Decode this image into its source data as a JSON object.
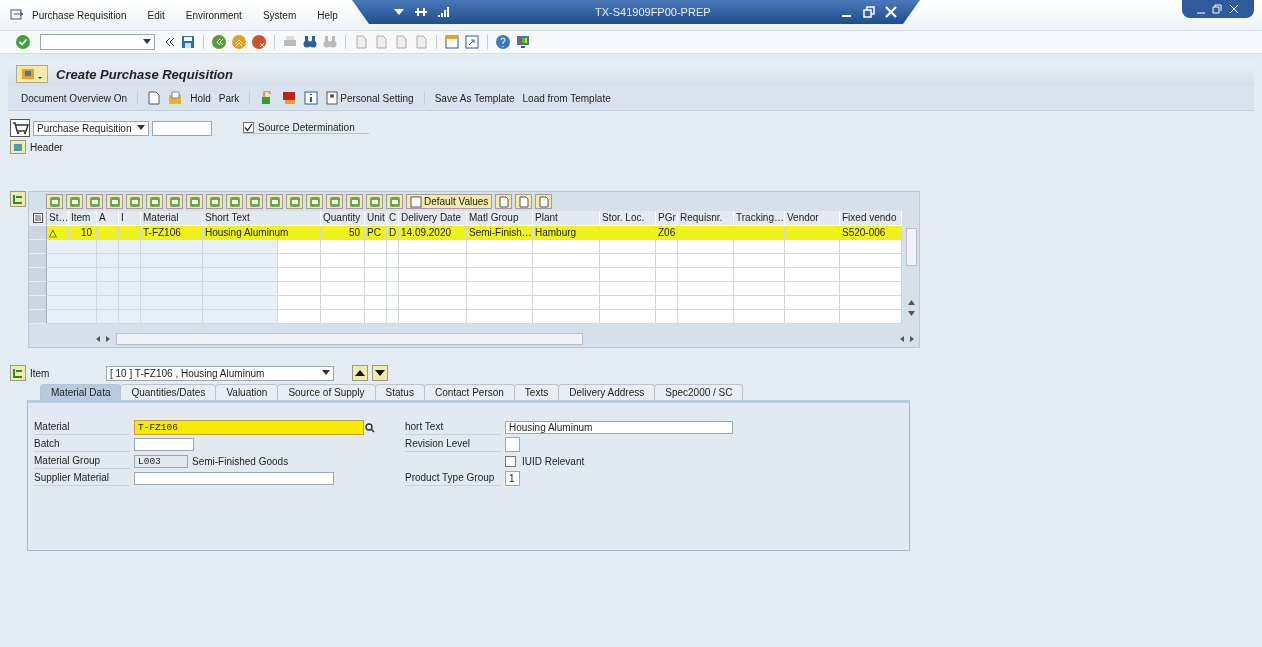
{
  "menu": [
    "Purchase Requisition",
    "Edit",
    "Environment",
    "System",
    "Help"
  ],
  "session_title": "TX-S41909FP00-PREP",
  "title": "Create Purchase Requisition",
  "app_toolbar": [
    "Document Overview On",
    "Hold",
    "Park",
    "Personal Setting",
    "Save As Template",
    "Load from Template"
  ],
  "header": {
    "doc_type": "Purchase Requisition",
    "source_determination": {
      "label": "Source Determination",
      "checked": true
    },
    "header_label": "Header"
  },
  "grid": {
    "default_values_button": "Default Values",
    "columns": [
      "St…",
      "Item",
      "A",
      "I",
      "Material",
      "Short Text",
      "Quantity",
      "Unit",
      "C",
      "Delivery Date",
      "Matl Group",
      "Plant",
      "Stor. Loc.",
      "PGr",
      "Requisnr.",
      "Tracking…",
      "Vendor",
      "Fixed vendo"
    ],
    "rows": [
      {
        "highlighted": true,
        "cells": [
          "△",
          "10",
          "",
          "",
          "T-FZ106",
          "Housing Aluminum",
          "50",
          "PC",
          "D",
          "14.09.2020",
          "Semi-Finish…",
          "Hamburg",
          "",
          "Z06",
          "",
          "",
          "",
          "S520-006"
        ]
      }
    ]
  },
  "item": {
    "label": "Item",
    "value": "[ 10 ] T-FZ106 , Housing Aluminum"
  },
  "tabs": [
    {
      "label": "Material Data",
      "selected": true
    },
    {
      "label": "Quantities/Dates",
      "selected": false
    },
    {
      "label": "Valuation",
      "selected": false
    },
    {
      "label": "Source of Supply",
      "selected": false
    },
    {
      "label": "Status",
      "selected": false
    },
    {
      "label": "Contact Person",
      "selected": false
    },
    {
      "label": "Texts",
      "selected": false
    },
    {
      "label": "Delivery Address",
      "selected": false
    },
    {
      "label": "Spec2000 / SC",
      "selected": false
    }
  ],
  "material_fields": {
    "material": {
      "label": "Material",
      "value": "T-FZ106",
      "highlighted": true
    },
    "batch": {
      "label": "Batch"
    },
    "material_group": {
      "label": "Material Group",
      "value": "L003",
      "description": "Semi-Finished Goods"
    },
    "supplier_material": {
      "label": "Supplier Material"
    },
    "short_text": {
      "label": "hort Text",
      "value": "Housing Aluminum"
    },
    "revision_level": {
      "label": "Revision Level"
    },
    "iuid": {
      "label": "IUID Relevant",
      "checked": false
    },
    "product_type_group": {
      "label": "Product Type Group",
      "value": "1"
    }
  }
}
